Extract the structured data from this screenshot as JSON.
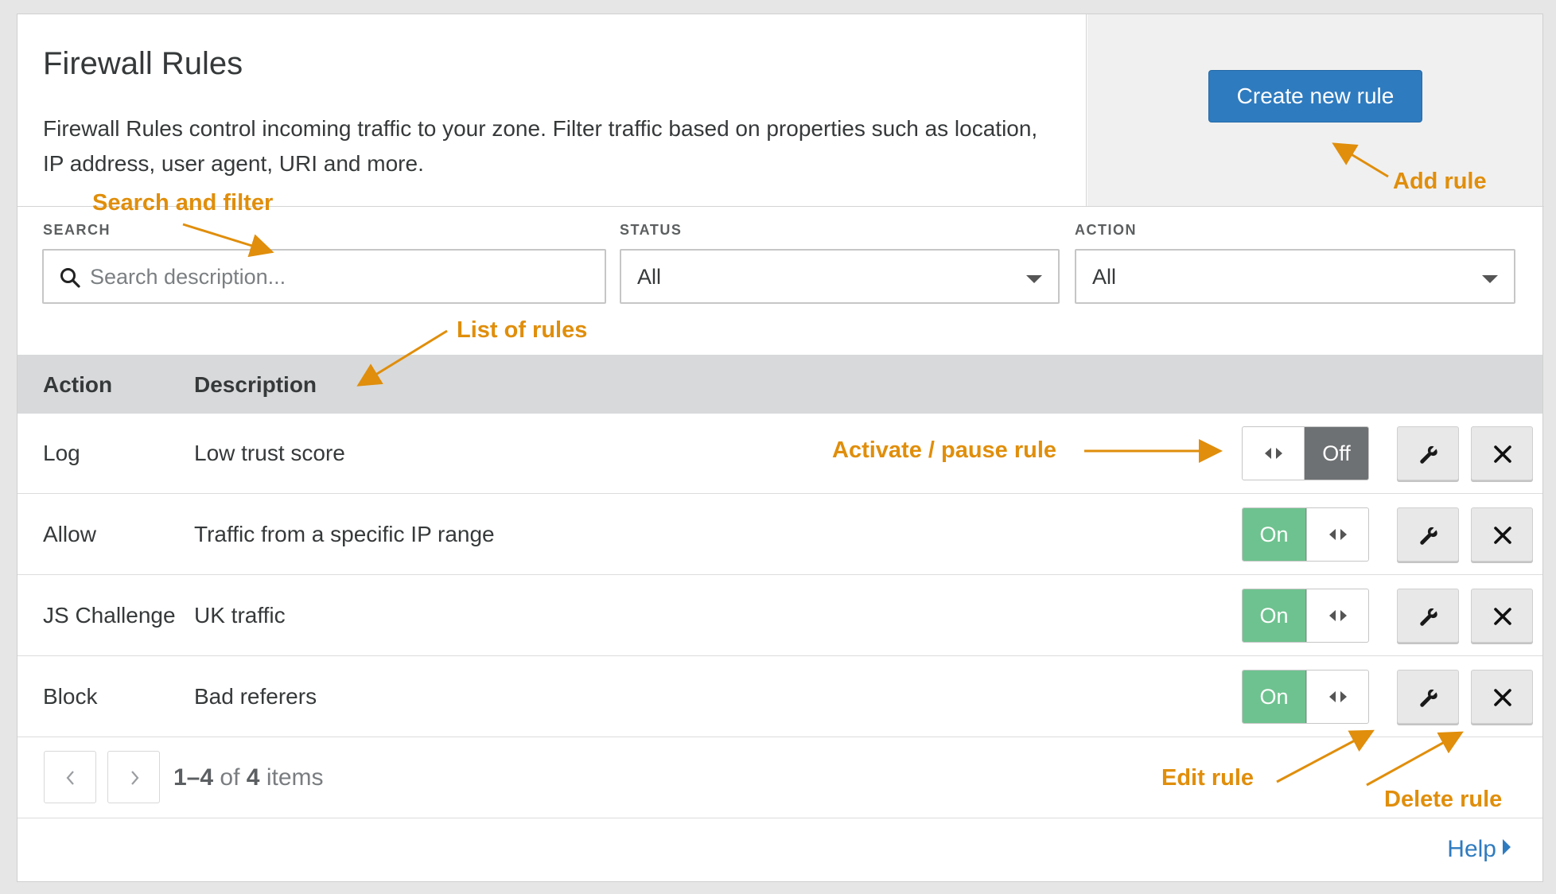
{
  "header": {
    "title": "Firewall Rules",
    "description": "Firewall Rules control incoming traffic to your zone. Filter traffic based on properties such as location, IP address, user agent, URI and more.",
    "create_button": "Create new rule"
  },
  "filters": {
    "search_label": "SEARCH",
    "search_placeholder": "Search description...",
    "status_label": "STATUS",
    "status_value": "All",
    "action_label": "ACTION",
    "action_value": "All"
  },
  "table": {
    "columns": [
      "Action",
      "Description"
    ],
    "rows": [
      {
        "action": "Log",
        "description": "Low trust score",
        "state": "Off",
        "enabled": false
      },
      {
        "action": "Allow",
        "description": "Traffic from a specific IP range",
        "state": "On",
        "enabled": true
      },
      {
        "action": "JS Challenge",
        "description": "UK traffic",
        "state": "On",
        "enabled": true
      },
      {
        "action": "Block",
        "description": "Bad referers",
        "state": "On",
        "enabled": true
      }
    ]
  },
  "pagination": {
    "range": "1–4",
    "of": "of",
    "total": "4",
    "unit": "items"
  },
  "footer": {
    "help": "Help"
  },
  "annotations": {
    "search_and_filter": "Search and filter",
    "add_rule": "Add rule",
    "list_of_rules": "List of rules",
    "activate_pause": "Activate / pause rule",
    "edit_rule": "Edit rule",
    "delete_rule": "Delete rule"
  },
  "icons": {
    "search": "search-icon",
    "edit": "wrench-icon",
    "delete": "close-icon",
    "toggle_handle": "drag-handle-icon",
    "prev": "chevron-left-icon",
    "next": "chevron-right-icon",
    "help_caret": "caret-right-icon"
  },
  "colors": {
    "primary": "#2f7bbf",
    "toggle_on": "#6ec28f",
    "toggle_off": "#6e7173",
    "annotation": "#e08e0b",
    "table_header": "#d8d9da"
  }
}
